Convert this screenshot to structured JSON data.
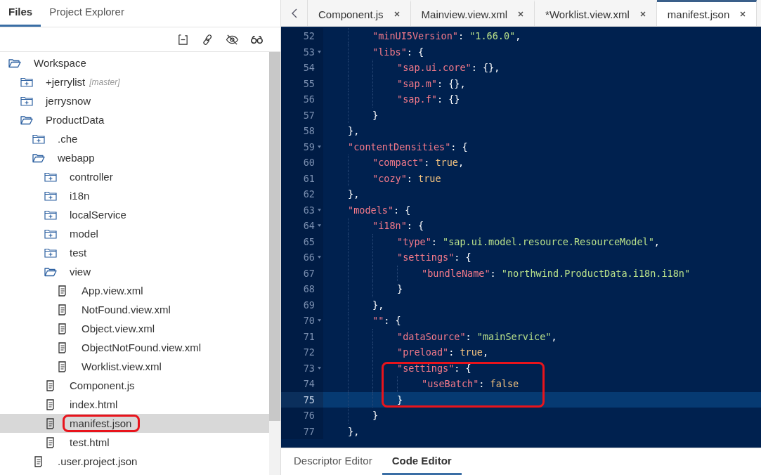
{
  "sidebar": {
    "tabs": [
      {
        "label": "Files",
        "selected": true
      },
      {
        "label": "Project Explorer",
        "selected": false
      }
    ],
    "tree": [
      {
        "label": "Workspace",
        "kind": "folder",
        "expanded": true,
        "selected": false,
        "children": [
          {
            "label": "+jerrylist",
            "branch": "[master]",
            "kind": "folder",
            "expanded": false,
            "selected": false
          },
          {
            "label": "jerrysnow",
            "kind": "folder",
            "expanded": false,
            "selected": false
          },
          {
            "label": "ProductData",
            "kind": "folder",
            "expanded": true,
            "selected": false,
            "children": [
              {
                "label": ".che",
                "kind": "folder",
                "expanded": false,
                "selected": false
              },
              {
                "label": "webapp",
                "kind": "folder",
                "expanded": true,
                "selected": false,
                "children": [
                  {
                    "label": "controller",
                    "kind": "folder",
                    "expanded": false,
                    "selected": false
                  },
                  {
                    "label": "i18n",
                    "kind": "folder",
                    "expanded": false,
                    "selected": false
                  },
                  {
                    "label": "localService",
                    "kind": "folder",
                    "expanded": false,
                    "selected": false
                  },
                  {
                    "label": "model",
                    "kind": "folder",
                    "expanded": false,
                    "selected": false
                  },
                  {
                    "label": "test",
                    "kind": "folder",
                    "expanded": false,
                    "selected": false
                  },
                  {
                    "label": "view",
                    "kind": "folder",
                    "expanded": true,
                    "selected": false,
                    "children": [
                      {
                        "label": "App.view.xml",
                        "kind": "file",
                        "selected": false
                      },
                      {
                        "label": "NotFound.view.xml",
                        "kind": "file",
                        "selected": false
                      },
                      {
                        "label": "Object.view.xml",
                        "kind": "file",
                        "selected": false
                      },
                      {
                        "label": "ObjectNotFound.view.xml",
                        "kind": "file",
                        "selected": false
                      },
                      {
                        "label": "Worklist.view.xml",
                        "kind": "file",
                        "selected": false
                      }
                    ]
                  },
                  {
                    "label": "Component.js",
                    "kind": "file",
                    "selected": false
                  },
                  {
                    "label": "index.html",
                    "kind": "file",
                    "selected": false
                  },
                  {
                    "label": "manifest.json",
                    "kind": "file",
                    "selected": true,
                    "annotated": true
                  },
                  {
                    "label": "test.html",
                    "kind": "file",
                    "selected": false
                  }
                ]
              },
              {
                "label": ".user.project.json",
                "kind": "file",
                "selected": false
              }
            ]
          }
        ]
      }
    ]
  },
  "editor": {
    "tabs": [
      {
        "label": "Component.js",
        "selected": false
      },
      {
        "label": "Mainview.view.xml",
        "selected": false
      },
      {
        "label": "*Worklist.view.xml",
        "selected": false
      },
      {
        "label": "manifest.json",
        "selected": true
      }
    ],
    "lines": [
      {
        "kind": "indent",
        "children": [
          {
            "kind": "line",
            "num": "52",
            "fold": false,
            "current": false,
            "tokens": [
              {
                "kind": "key",
                "text": "\"minUI5Version\""
              },
              {
                "kind": "punct",
                "text": ": "
              },
              {
                "kind": "str",
                "text": "\"1.66.0\""
              },
              {
                "kind": "punct",
                "text": ","
              }
            ]
          },
          {
            "kind": "line",
            "num": "53",
            "fold": true,
            "current": false,
            "tokens": [
              {
                "kind": "key",
                "text": "\"libs\""
              },
              {
                "kind": "punct",
                "text": ": {"
              }
            ],
            "children": [
              {
                "kind": "line",
                "num": "54",
                "fold": false,
                "current": false,
                "tokens": [
                  {
                    "kind": "key",
                    "text": "\"sap.ui.core\""
                  },
                  {
                    "kind": "punct",
                    "text": ": {},"
                  }
                ]
              },
              {
                "kind": "line",
                "num": "55",
                "fold": false,
                "current": false,
                "tokens": [
                  {
                    "kind": "key",
                    "text": "\"sap.m\""
                  },
                  {
                    "kind": "punct",
                    "text": ": {},"
                  }
                ]
              },
              {
                "kind": "line",
                "num": "56",
                "fold": false,
                "current": false,
                "tokens": [
                  {
                    "kind": "key",
                    "text": "\"sap.f\""
                  },
                  {
                    "kind": "punct",
                    "text": ": {}"
                  }
                ]
              }
            ]
          },
          {
            "kind": "line",
            "num": "57",
            "fold": false,
            "current": false,
            "tokens": [
              {
                "kind": "punct",
                "text": "}"
              }
            ]
          }
        ]
      },
      {
        "kind": "line",
        "num": "58",
        "fold": false,
        "current": false,
        "tokens": [
          {
            "kind": "punct",
            "text": "},"
          }
        ]
      },
      {
        "kind": "line",
        "num": "59",
        "fold": true,
        "current": false,
        "tokens": [
          {
            "kind": "key",
            "text": "\"contentDensities\""
          },
          {
            "kind": "punct",
            "text": ": {"
          }
        ],
        "children": [
          {
            "kind": "line",
            "num": "60",
            "fold": false,
            "current": false,
            "tokens": [
              {
                "kind": "key",
                "text": "\"compact\""
              },
              {
                "kind": "punct",
                "text": ": "
              },
              {
                "kind": "bool",
                "text": "true"
              },
              {
                "kind": "punct",
                "text": ","
              }
            ]
          },
          {
            "kind": "line",
            "num": "61",
            "fold": false,
            "current": false,
            "tokens": [
              {
                "kind": "key",
                "text": "\"cozy\""
              },
              {
                "kind": "punct",
                "text": ": "
              },
              {
                "kind": "bool",
                "text": "true"
              }
            ]
          }
        ]
      },
      {
        "kind": "line",
        "num": "62",
        "fold": false,
        "current": false,
        "tokens": [
          {
            "kind": "punct",
            "text": "},"
          }
        ]
      },
      {
        "kind": "line",
        "num": "63",
        "fold": true,
        "current": false,
        "tokens": [
          {
            "kind": "key",
            "text": "\"models\""
          },
          {
            "kind": "punct",
            "text": ": {"
          }
        ],
        "children": [
          {
            "kind": "line",
            "num": "64",
            "fold": true,
            "current": false,
            "tokens": [
              {
                "kind": "key",
                "text": "\"i18n\""
              },
              {
                "kind": "punct",
                "text": ": {"
              }
            ],
            "children": [
              {
                "kind": "line",
                "num": "65",
                "fold": false,
                "current": false,
                "tokens": [
                  {
                    "kind": "key",
                    "text": "\"type\""
                  },
                  {
                    "kind": "punct",
                    "text": ": "
                  },
                  {
                    "kind": "str",
                    "text": "\"sap.ui.model.resource.ResourceModel\""
                  },
                  {
                    "kind": "punct",
                    "text": ","
                  }
                ]
              },
              {
                "kind": "line",
                "num": "66",
                "fold": true,
                "current": false,
                "tokens": [
                  {
                    "kind": "key",
                    "text": "\"settings\""
                  },
                  {
                    "kind": "punct",
                    "text": ": {"
                  }
                ],
                "children": [
                  {
                    "kind": "line",
                    "num": "67",
                    "fold": false,
                    "current": false,
                    "tokens": [
                      {
                        "kind": "key",
                        "text": "\"bundleName\""
                      },
                      {
                        "kind": "punct",
                        "text": ": "
                      },
                      {
                        "kind": "str",
                        "text": "\"northwind.ProductData.i18n.i18n\""
                      }
                    ]
                  }
                ]
              },
              {
                "kind": "line",
                "num": "68",
                "fold": false,
                "current": false,
                "tokens": [
                  {
                    "kind": "punct",
                    "text": "}"
                  }
                ]
              }
            ]
          },
          {
            "kind": "line",
            "num": "69",
            "fold": false,
            "current": false,
            "tokens": [
              {
                "kind": "punct",
                "text": "},"
              }
            ]
          },
          {
            "kind": "line",
            "num": "70",
            "fold": true,
            "current": false,
            "tokens": [
              {
                "kind": "key",
                "text": "\"\""
              },
              {
                "kind": "punct",
                "text": ": {"
              }
            ],
            "children": [
              {
                "kind": "line",
                "num": "71",
                "fold": false,
                "current": false,
                "tokens": [
                  {
                    "kind": "key",
                    "text": "\"dataSource\""
                  },
                  {
                    "kind": "punct",
                    "text": ": "
                  },
                  {
                    "kind": "str",
                    "text": "\"mainService\""
                  },
                  {
                    "kind": "punct",
                    "text": ","
                  }
                ]
              },
              {
                "kind": "line",
                "num": "72",
                "fold": false,
                "current": false,
                "tokens": [
                  {
                    "kind": "key",
                    "text": "\"preload\""
                  },
                  {
                    "kind": "punct",
                    "text": ": "
                  },
                  {
                    "kind": "bool",
                    "text": "true"
                  },
                  {
                    "kind": "punct",
                    "text": ","
                  }
                ]
              },
              {
                "kind": "annotation",
                "children": [
                  {
                    "kind": "line",
                    "num": "73",
                    "fold": true,
                    "current": false,
                    "tokens": [
                      {
                        "kind": "key",
                        "text": "\"settings\""
                      },
                      {
                        "kind": "punct",
                        "text": ": {"
                      }
                    ],
                    "children": [
                      {
                        "kind": "line",
                        "num": "74",
                        "fold": false,
                        "current": false,
                        "tokens": [
                          {
                            "kind": "key",
                            "text": "\"useBatch\""
                          },
                          {
                            "kind": "punct",
                            "text": ": "
                          },
                          {
                            "kind": "bool",
                            "text": "false"
                          }
                        ]
                      }
                    ]
                  },
                  {
                    "kind": "line",
                    "num": "75",
                    "fold": false,
                    "current": true,
                    "tokens": [
                      {
                        "kind": "punct",
                        "text": "}"
                      }
                    ]
                  }
                ]
              }
            ]
          },
          {
            "kind": "line",
            "num": "76",
            "fold": false,
            "current": false,
            "tokens": [
              {
                "kind": "punct",
                "text": "}"
              }
            ]
          }
        ]
      },
      {
        "kind": "line",
        "num": "77",
        "fold": false,
        "current": false,
        "tokens": [
          {
            "kind": "punct",
            "text": "},"
          }
        ]
      }
    ],
    "bottom_tabs": [
      {
        "label": "Descriptor Editor",
        "selected": false
      },
      {
        "label": "Code Editor",
        "selected": true
      }
    ]
  }
}
